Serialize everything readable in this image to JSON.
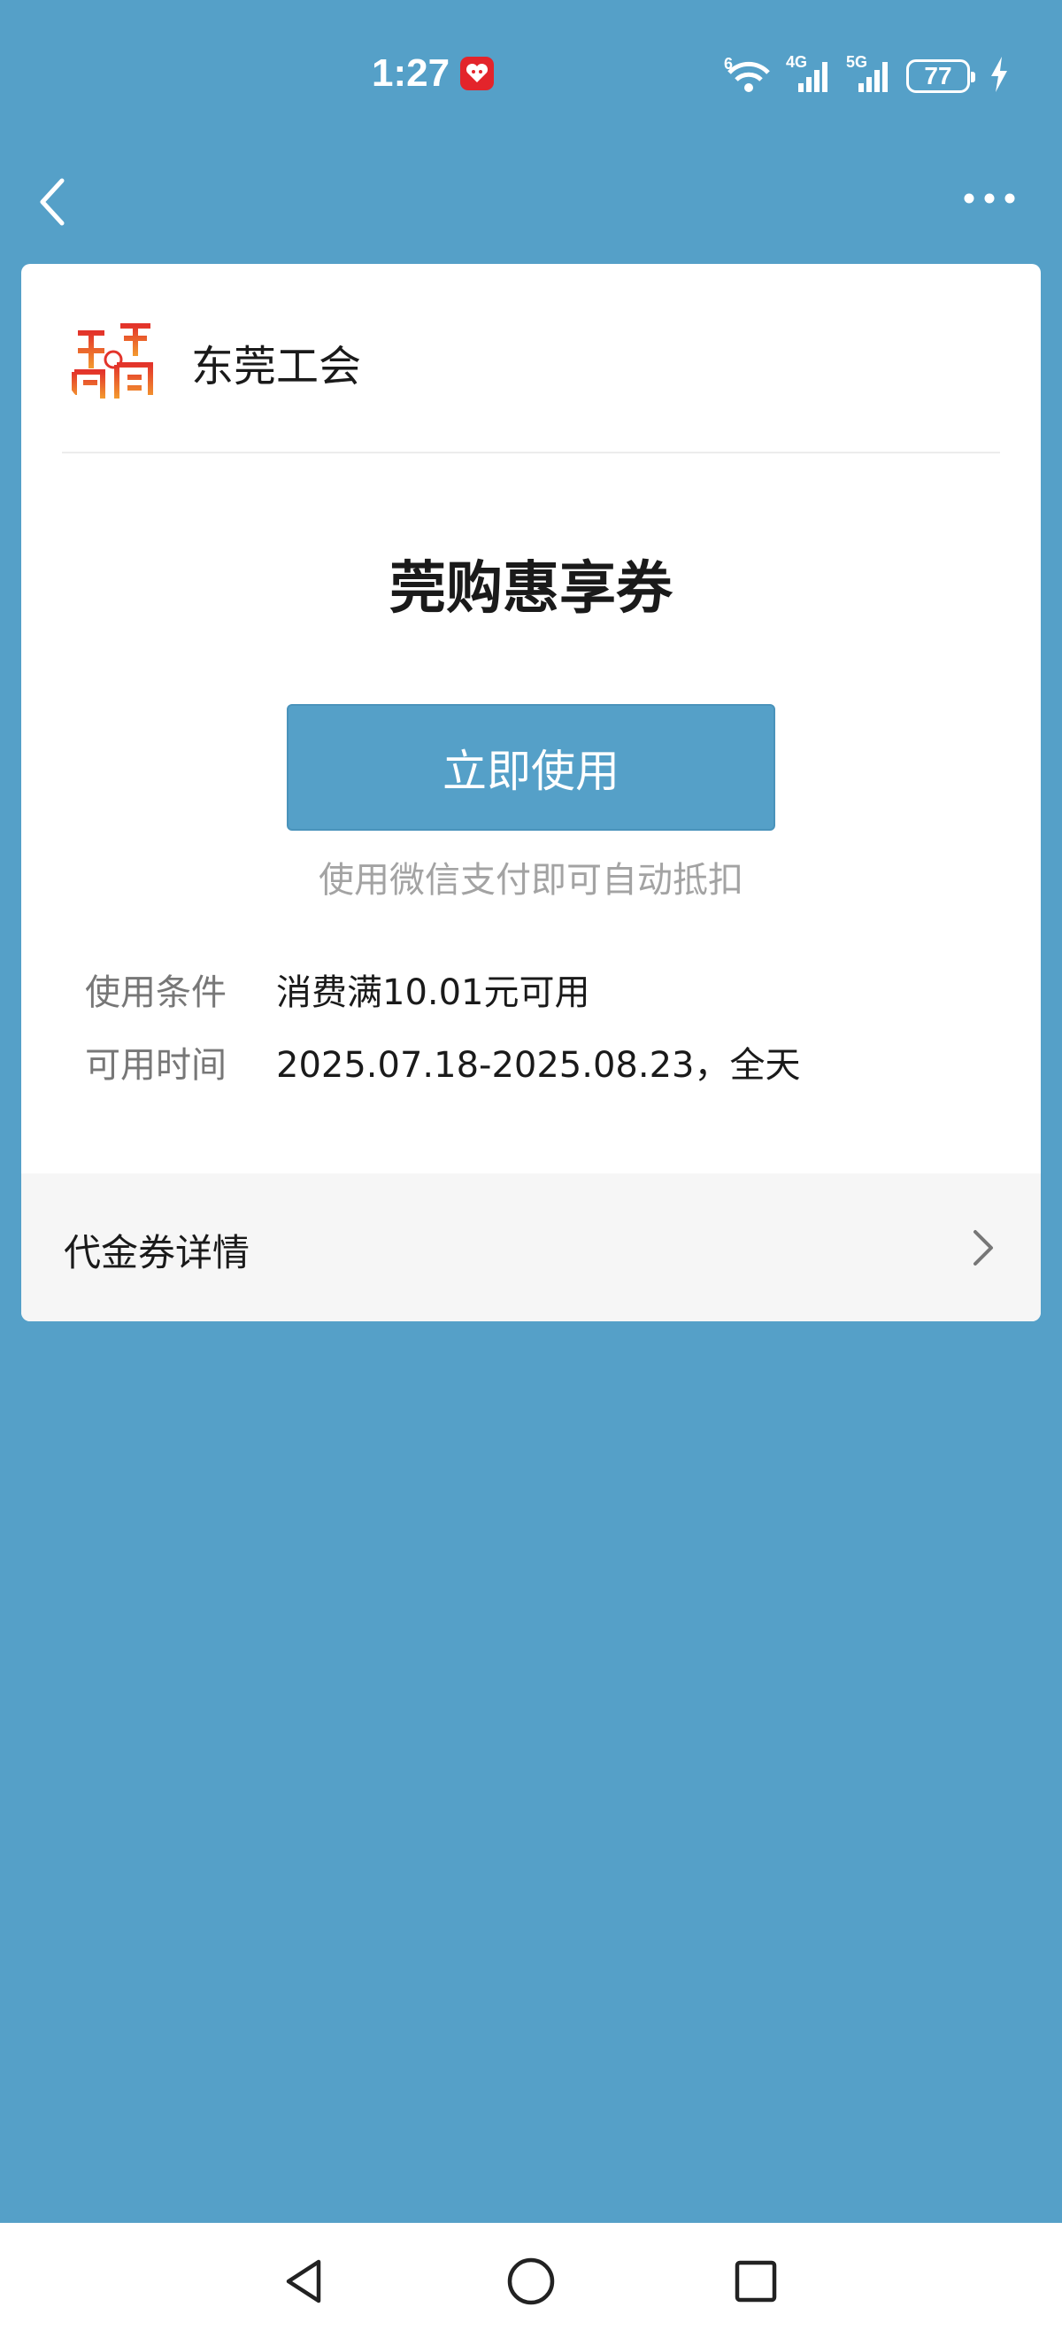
{
  "status_bar": {
    "time": "1:27",
    "wifi_label": "6",
    "signal1_label": "4G",
    "signal2_label": "5G",
    "battery": "77"
  },
  "header": {
    "org_name": "东莞工会"
  },
  "coupon": {
    "title": "莞购惠享券",
    "use_button": "立即使用",
    "hint": "使用微信支付即可自动抵扣"
  },
  "conditions": {
    "label": "使用条件",
    "value": "消费满10.01元可用"
  },
  "validity": {
    "label": "可用时间",
    "value": "2025.07.18-2025.08.23，全天"
  },
  "details": {
    "label": "代金券详情"
  },
  "colors": {
    "background": "#55a0c8",
    "button": "#55a0c8",
    "card": "#ffffff",
    "hint_text": "#a3a3a3"
  },
  "icons": [
    "back-arrow-icon",
    "more-dots-icon",
    "chevron-right-icon",
    "wifi-icon",
    "signal-icon",
    "battery-icon",
    "charging-icon",
    "nav-back-icon",
    "nav-home-icon",
    "nav-recent-icon"
  ]
}
